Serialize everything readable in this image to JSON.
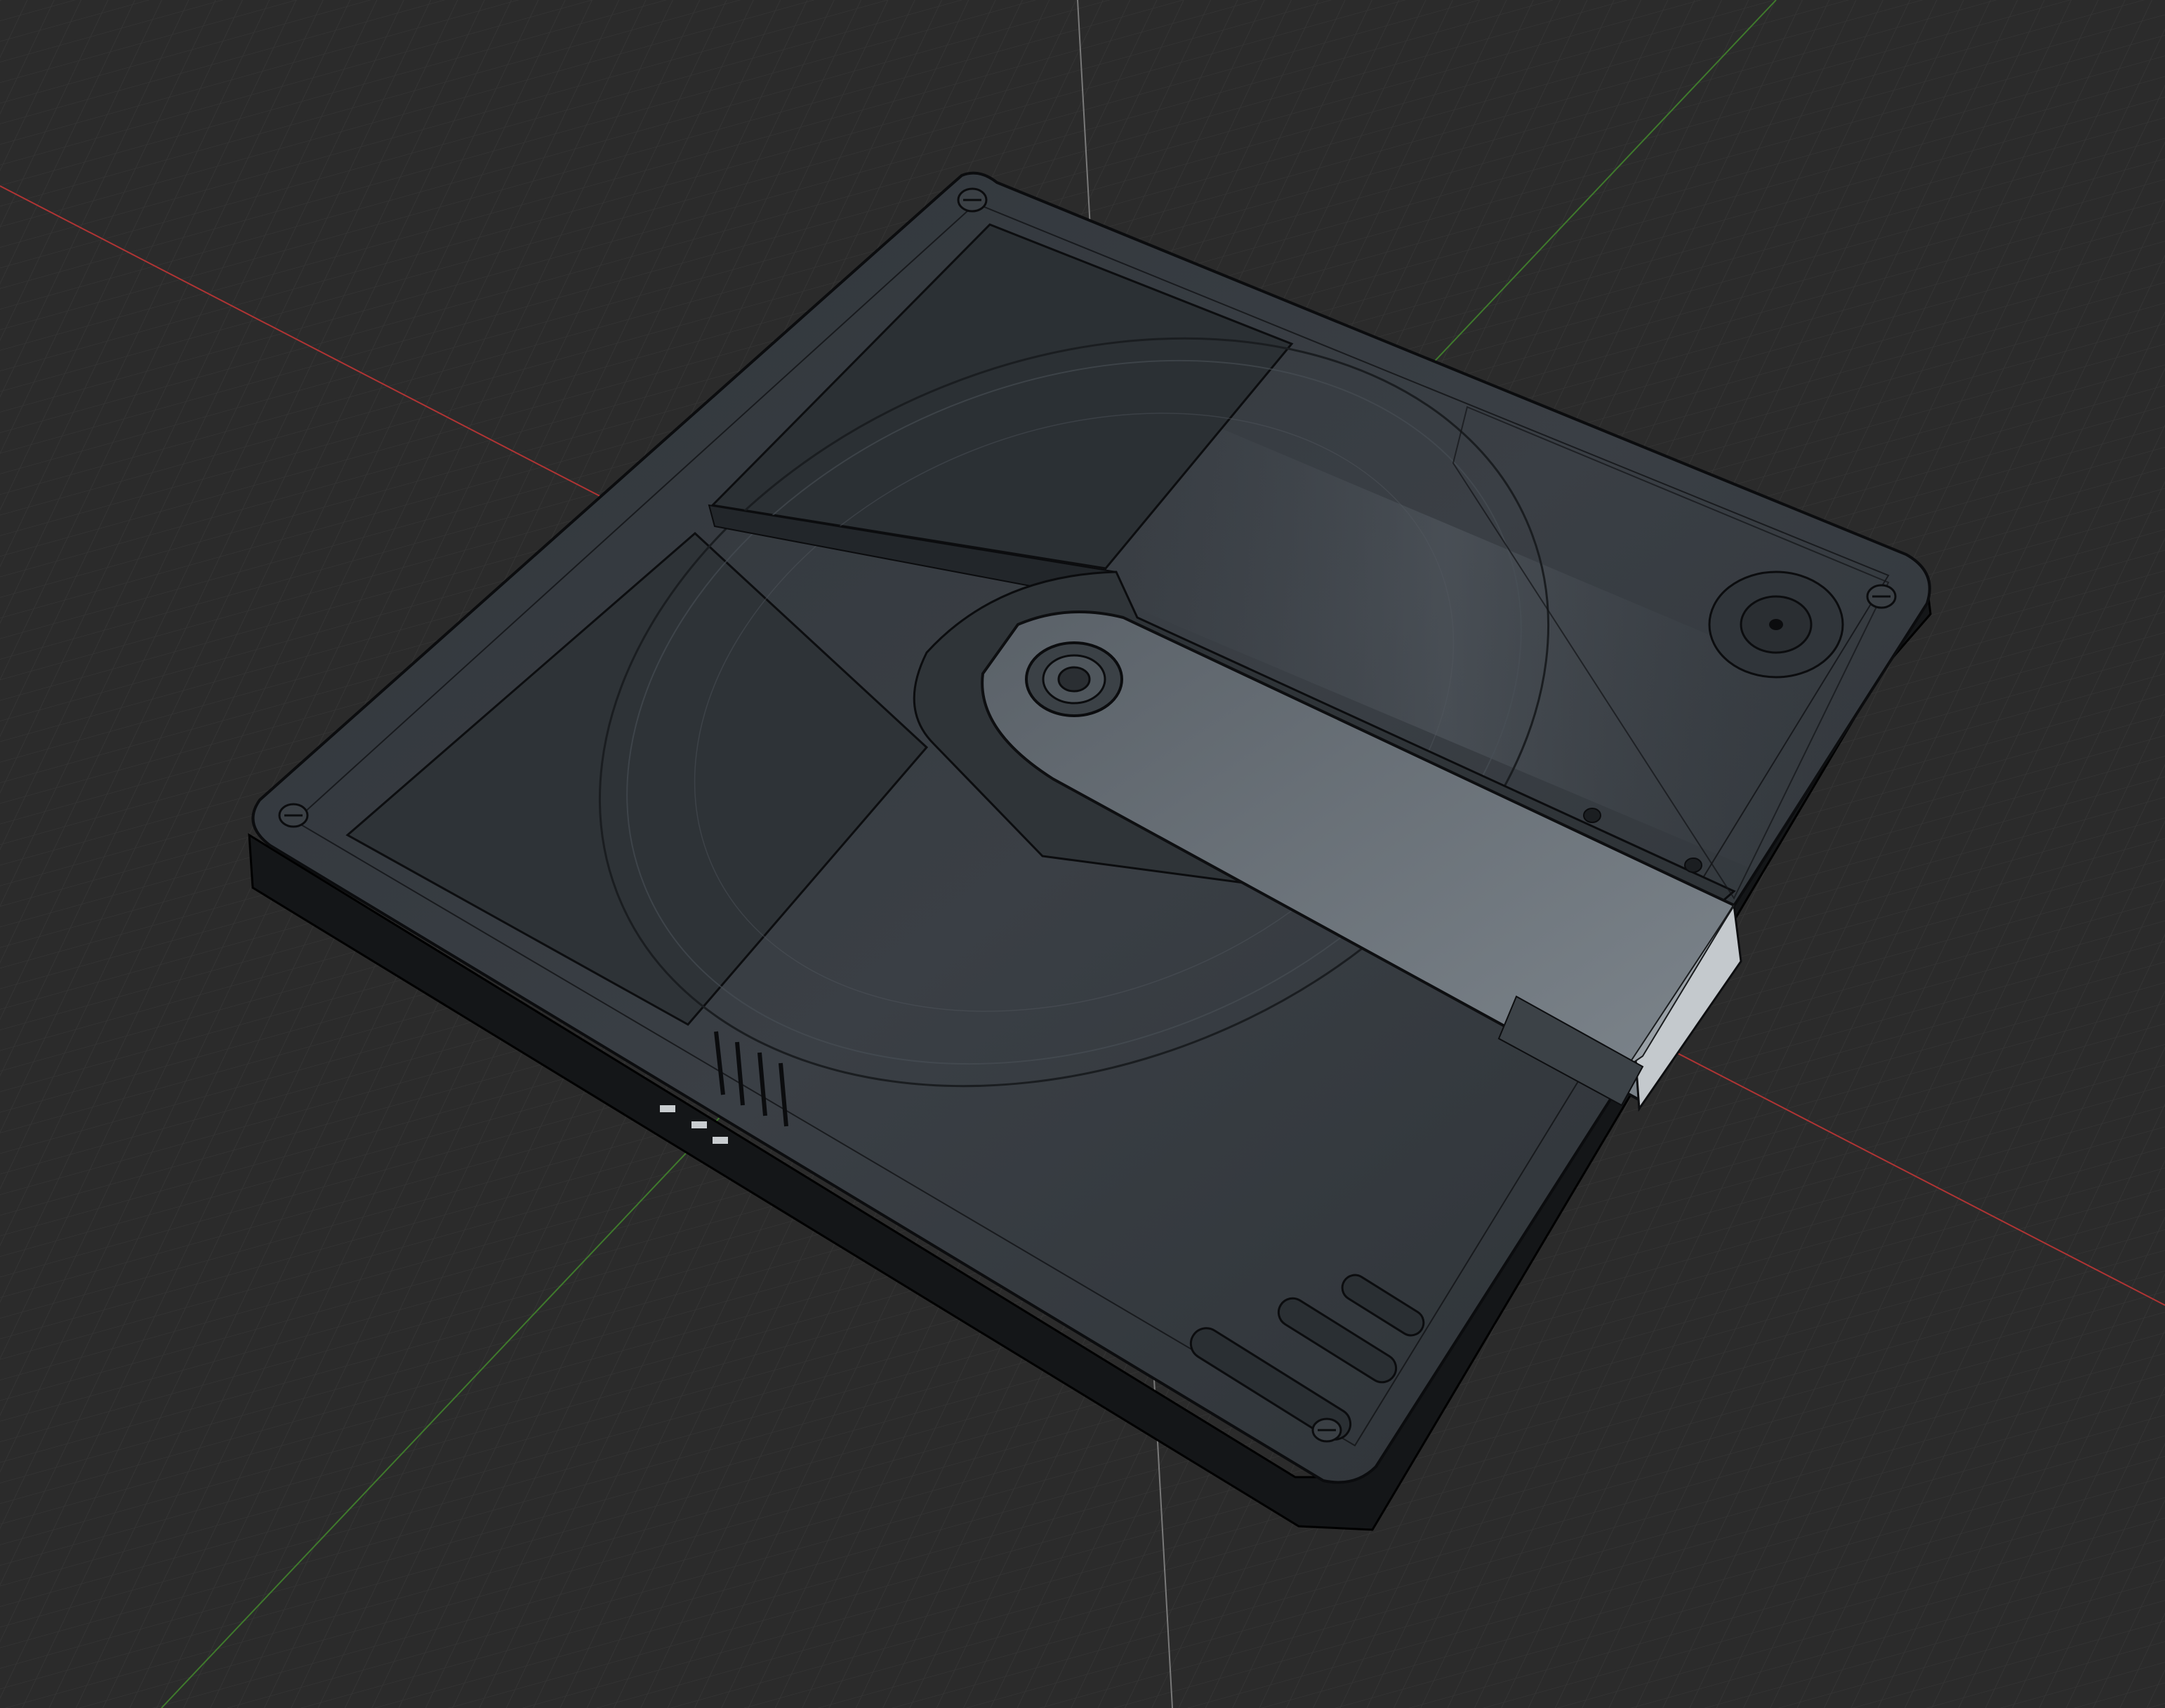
{
  "viewport": {
    "background_color": "#2b2b2b",
    "grid_color": "#353535",
    "x_axis_color": "#b03434",
    "y_axis_color": "#3f7a2c",
    "z_axis_color": "#9a9a9a"
  },
  "model": {
    "body_color": "#2c3034",
    "top_color": "#33383d",
    "edge_color": "#0b0c0e",
    "shutter_color": "#5f666d",
    "panel_color": "#272b2f",
    "screw_count": 4,
    "shading": "x-ray wireframe"
  }
}
